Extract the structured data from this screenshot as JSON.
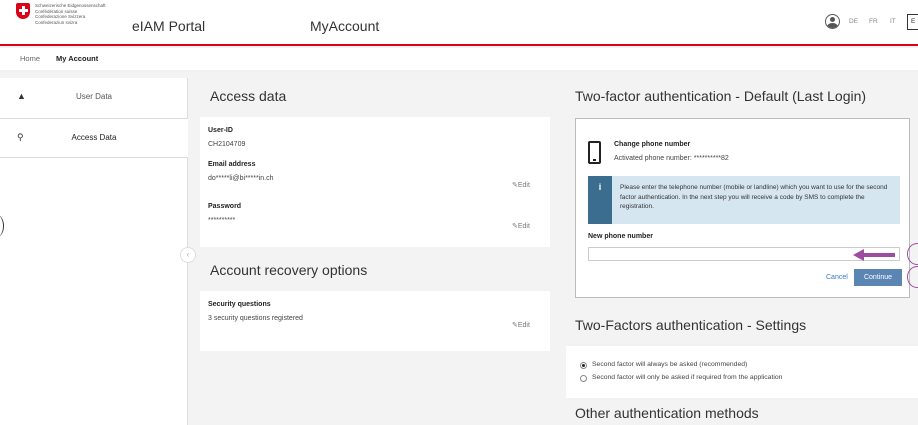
{
  "header": {
    "confederation_lines": [
      "Schweizerische Eidgenossenschaft",
      "Confédération suisse",
      "Confederazione Svizzera",
      "Confederaziun svizra"
    ],
    "app_title": "eIAM Portal",
    "page_title": "MyAccount",
    "languages": [
      "DE",
      "FR",
      "IT"
    ],
    "active_language": "E"
  },
  "breadcrumb": {
    "home": "Home",
    "current": "My Account"
  },
  "sidebar": {
    "items": [
      {
        "label": "User Data",
        "icon": "user-icon"
      },
      {
        "label": "Access Data",
        "icon": "key-icon"
      }
    ],
    "collapse_glyph": "‹"
  },
  "access_data": {
    "title": "Access data",
    "userid_label": "User-ID",
    "userid_value": "CH2104709",
    "email_label": "Email address",
    "email_value": "do*****li@bi*****in.ch",
    "password_label": "Password",
    "password_value": "**********",
    "edit_label": "Edit"
  },
  "recovery": {
    "title": "Account recovery options",
    "security_label": "Security questions",
    "security_value": "3 security questions registered",
    "edit_label": "Edit"
  },
  "tfa": {
    "title": "Two-factor authentication - Default (Last Login)",
    "change_title": "Change phone number",
    "activated_text": "Activated phone number: **********82",
    "info_glyph": "i",
    "info_text": "Please enter the telephone number (mobile or landline) which you want to use for the second factor authentication. In the next step you will receive a code by SMS to complete the registration.",
    "new_phone_label": "New phone number",
    "new_phone_value": "",
    "cancel_label": "Cancel",
    "continue_label": "Continue"
  },
  "tfa_settings": {
    "title": "Two-Factors authentication - Settings",
    "option_always": "Second factor will always be asked (recommended)",
    "option_required": "Second factor will only be asked if required from the application",
    "selected": "always"
  },
  "other_methods": {
    "title": "Other authentication methods"
  },
  "colors": {
    "brand_red": "#dc0018",
    "annotation_purple": "#9b4ea0",
    "button_blue": "#5b86b3"
  }
}
